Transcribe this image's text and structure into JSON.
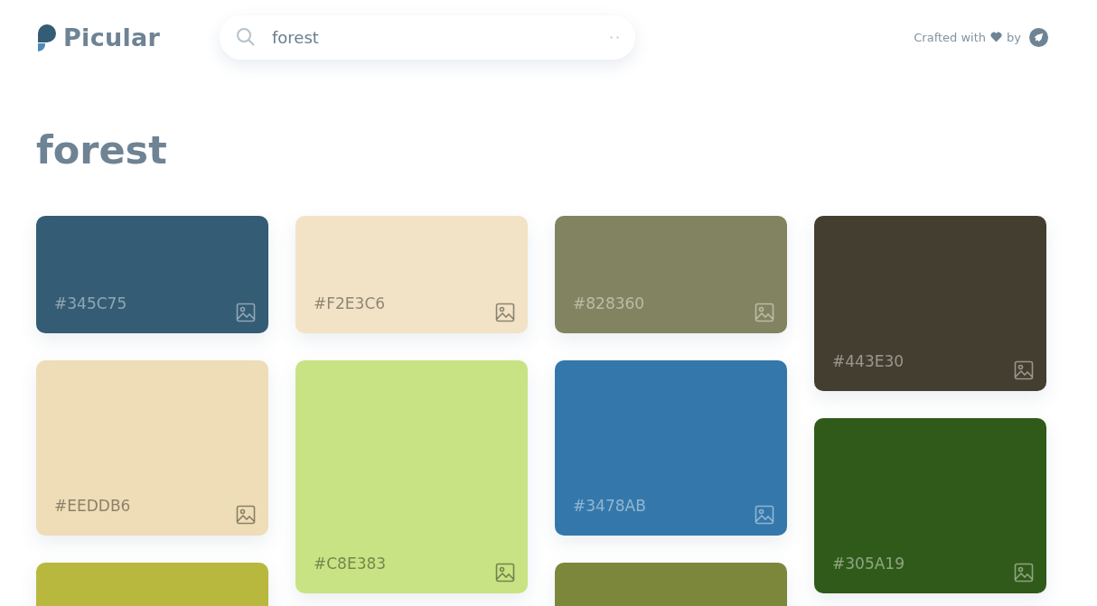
{
  "header": {
    "logo": "Picular",
    "search": {
      "value": "forest"
    },
    "credit": "Crafted with",
    "credit_by": "by"
  },
  "title": "forest",
  "columns": [
    {
      "cards": [
        {
          "label": "#345C75",
          "color": "#345c75",
          "kind": "short"
        },
        {
          "label": "#EEDDB6",
          "color": "#eeddb6",
          "kind": "medium"
        },
        {
          "color": "#b8b83e",
          "kind": "medium"
        }
      ]
    },
    {
      "cards": [
        {
          "label": "#F2E3C6",
          "color": "#f2e3c6",
          "kind": "short"
        },
        {
          "label": "#C8E383",
          "color": "#c8e383",
          "kind": "tall"
        }
      ]
    },
    {
      "cards": [
        {
          "label": "#828360",
          "color": "#828360",
          "kind": "short"
        },
        {
          "label": "#3478AB",
          "color": "#3478ab",
          "kind": "medium"
        },
        {
          "color": "#7c873c",
          "kind": "medium"
        }
      ]
    },
    {
      "cards": [
        {
          "label": "#443E30",
          "color": "#443e30",
          "kind": "medium"
        },
        {
          "label": "#305A19",
          "color": "#305a19",
          "kind": "medium"
        }
      ]
    }
  ]
}
